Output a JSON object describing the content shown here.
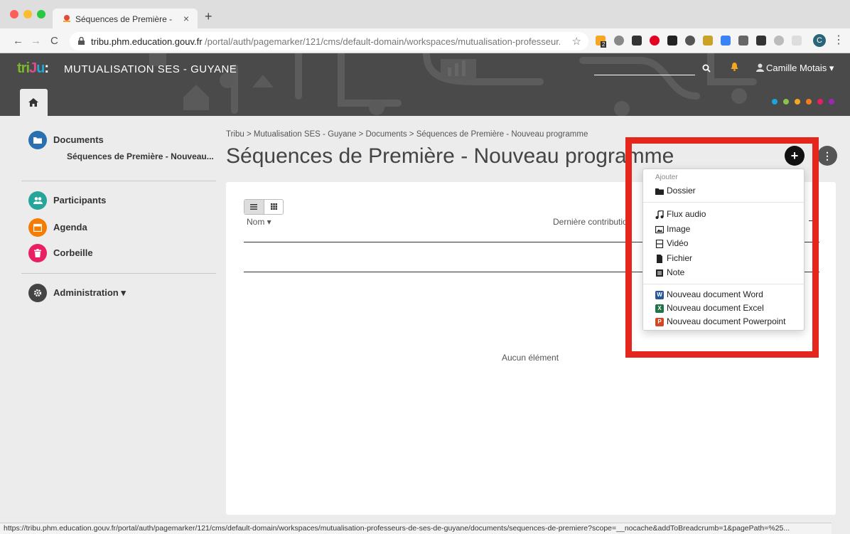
{
  "browser": {
    "tab_title": "Séquences de Première - Nouv",
    "tab_close": "×",
    "new_tab": "+",
    "back": "←",
    "forward": "→",
    "reload": "C",
    "url_host": "tribu.phm.education.gouv.fr",
    "url_path": "/portal/auth/pagemarker/121/cms/default-domain/workspaces/mutualisation-professeur...",
    "star": "☆",
    "profile_initial": "C",
    "menu": "⋮",
    "ext_badge": "2",
    "status_url": "https://tribu.phm.education.gouv.fr/portal/auth/pagemarker/121/cms/default-domain/workspaces/mutualisation-professeurs-de-ses-de-guyane/documents/sequences-de-premiere?scope=__nocache&addToBreadcrumb=1&pagePath=%25..."
  },
  "header": {
    "logo": {
      "t": "tri",
      "j": "J",
      "u": "u",
      "sep": ":"
    },
    "site_title": "MUTUALISATION SES - GUYANE",
    "user_name": "Camille Motais ▾",
    "dot_colors": [
      "#1aa6d9",
      "#8bc34a",
      "#f5a623",
      "#f57c20",
      "#e91e63",
      "#9c27b0"
    ]
  },
  "sidebar": {
    "documents": "Documents",
    "current_folder": "Séquences de Première - Nouveau...",
    "participants": "Participants",
    "agenda": "Agenda",
    "corbeille": "Corbeille",
    "administration": "Administration ▾",
    "colors": {
      "documents": "#2a6fb0",
      "participants": "#26a69a",
      "agenda": "#f57c00",
      "corbeille": "#e91e63",
      "administration": "#444444"
    }
  },
  "main": {
    "breadcrumb": "Tribu > Mutualisation SES - Guyane > Documents > Séquences de Première - Nouveau programme",
    "title": "Séquences de Première - Nouveau programme",
    "add_button": "+",
    "more_button": "⋮",
    "col_name": "Nom ▾",
    "col_date": "Dernière contribution",
    "empty": "Aucun élément"
  },
  "dropdown": {
    "header": "Ajouter",
    "dossier": "Dossier",
    "flux_audio": "Flux audio",
    "image": "Image",
    "video": "Vidéo",
    "fichier": "Fichier",
    "note": "Note",
    "word": "Nouveau document Word",
    "excel": "Nouveau document Excel",
    "powerpoint": "Nouveau document Powerpoint",
    "word_letter": "W",
    "excel_letter": "X",
    "ppt_letter": "P"
  },
  "accent": {
    "highlight": "#e5261d",
    "word": "#2b579a",
    "excel": "#217346",
    "powerpoint": "#d24726"
  }
}
